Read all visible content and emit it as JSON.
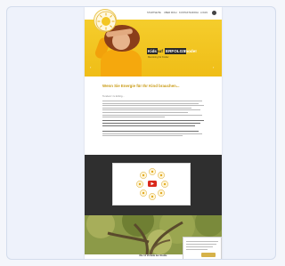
{
  "nav": {
    "items": [
      "STARTSEITE",
      "ÜBER MICH",
      "KONTAKTANFRAGE",
      "LOGIN"
    ]
  },
  "logo": {
    "name": "brand-seal-logo"
  },
  "hero": {
    "headline_parts": [
      "Kids",
      "auf",
      "ERFOLGS",
      "mode!"
    ],
    "subline": "Mentoring für Kinder",
    "prev_icon": "‹",
    "next_icon": "›"
  },
  "intro": {
    "title": "Wenn Sie Energie für Ihr Kind brauchen...",
    "kicker": "Tendenz zu Erfolg..."
  },
  "video": {
    "play_icon": "play-icon"
  },
  "bottom": {
    "title": "Die 11 Vorteile der Studie"
  },
  "colors": {
    "brand_yellow": "#f1c21b",
    "headline_gold": "#c99a12",
    "dark_section": "#2f2f2f",
    "play_red": "#d9281c"
  }
}
